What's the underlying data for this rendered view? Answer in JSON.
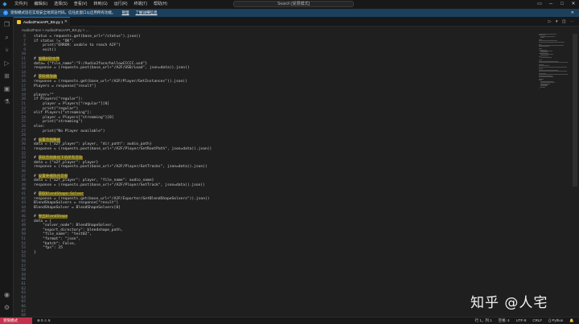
{
  "titlebar": {
    "menu": [
      "文件(F)",
      "编辑(E)",
      "选择(S)",
      "查看(V)",
      "转到(G)",
      "运行(R)",
      "终端(T)",
      "帮助(H)"
    ],
    "search": "Search [受限模式]"
  },
  "banner": {
    "text": "受限模式旨在实现安全地浏览代码。信任此窗口以启用所有功能。",
    "manage": "管理",
    "learn_more": "了解详细信息"
  },
  "tab": {
    "label": "Audio2FaceAPI_BS.py 1"
  },
  "breadcrumb": "Audio2Face > Audio2FaceAPI_BS.py > ...",
  "code": {
    "line_numbers": [
      6,
      7,
      8,
      9,
      10,
      11,
      12,
      13,
      14,
      15,
      16,
      17,
      18,
      19,
      20,
      21,
      22,
      23,
      24,
      25,
      26,
      27,
      28,
      29,
      30,
      31,
      32,
      33,
      34,
      35,
      36,
      37,
      38,
      39,
      40,
      41,
      42,
      43,
      44,
      45,
      46,
      47,
      48,
      49,
      50,
      51,
      52,
      53,
      54,
      55,
      56,
      57,
      58,
      59,
      60,
      61,
      62,
      63,
      64,
      65,
      66,
      67,
      68
    ],
    "lines": [
      "status = requests.get(base_url+\"/status\").json()",
      "if status != \"OK\":",
      "    print(\"ERROR: unable to reach A2F\")",
      "    exit()",
      "",
      "# 加载USD文件",
      "data= {\"file_name\":\"F:/Audio2face/hellowCCCCC.usd\"}",
      "response = (requests.post(base_url+\"/A2F/USD/Load\", json=data)).json()",
      "",
      "# 获取播放器",
      "response = (requests.get(base_url+\"/A2F/Player/GetInstances\")).json()",
      "Players = response[\"result\"]",
      "",
      "player=\"\"",
      "if Players[\"regular\"]:",
      "    player = Players[\"regular\"][0]",
      "    print(\"regular\")",
      "elif Players[\"streaming\"]:",
      "    player = Players[\"streaming\"][0]",
      "    print(\"streaming\")",
      "else:",
      "    print(\"No Player available\")",
      "",
      "# 设置音频路径",
      "data = {\"a2f_player\": player, \"dir_path\": audio_path}",
      "response = (requests.post(base_url+\"/A2F/Player/SetRootPath\", json=data)).json()",
      "",
      "# 获取音频路径下的所有音轨",
      "data = {\"a2f_player\": player}",
      "response = (requests.post(base_url+\"/A2F/Player/GetTracks\", json=data)).json()",
      "",
      "# 设置要播放的音频",
      "data = {\"a2f_player\": player, \"file_name\": audio_name}",
      "response = (requests.post(base_url+\"/A2F/Player/SetTrack\", json=data)).json()",
      "",
      "# 获取BlendShape Solver",
      "response = (requests.get(base_url+\"/A2F/Exporter/GetBlendShapeSolvers\")).json()",
      "BlendShapeSolvers = response[\"result\"]",
      "BlendShapeSolver = BlendShapeSolvers[0]",
      "",
      "# 导出BlendShape",
      "data = {",
      "    \"solver_node\": BlendShapeSolver,",
      "    \"export_directory\": blendshape_path,",
      "    \"file_name\": \"test02\",",
      "    \"format\": \"json\",",
      "    \"batch\": False,",
      "    \"fps\": 25",
      "}",
      "",
      "",
      "",
      "",
      "",
      "",
      "",
      "",
      "",
      "",
      "",
      "",
      "",
      ""
    ],
    "highlighted_comments": [
      "加载USD文件",
      "获取播放器",
      "设置音频路径",
      "获取音频路径下的所有音轨",
      "设置要播放的音频",
      "获取BlendShape Solver",
      "导出BlendShape"
    ]
  },
  "watermark": "知乎 @人宅",
  "statusbar": {
    "remote": "受限模式",
    "problems": "⊗ 0  ⚠ 6",
    "position": "行 1，列 1",
    "spaces": "空格: 4",
    "encoding": "UTF-8",
    "eol": "CRLF",
    "language": "{} Python",
    "bell": "🔔"
  }
}
